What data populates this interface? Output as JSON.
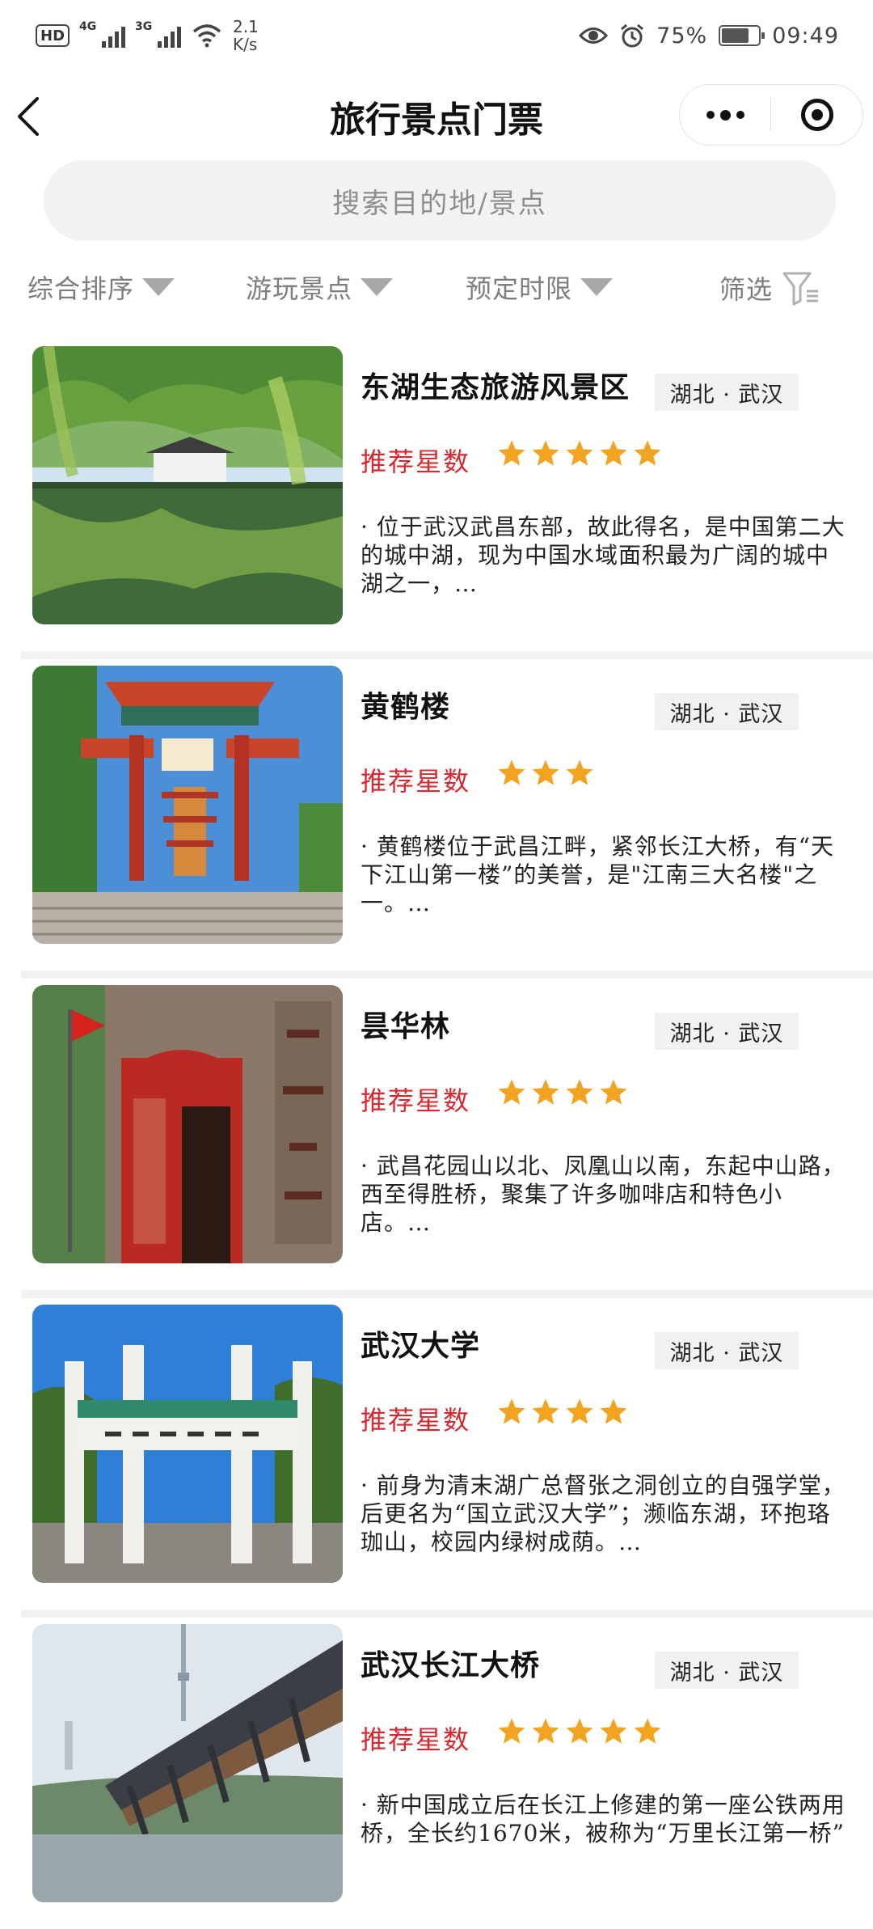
{
  "status_bar": {
    "hd": "HD",
    "net_4g": "4G",
    "net_3g": "3G",
    "speed_value": "2.1",
    "speed_unit": "K/s",
    "battery": "75%",
    "battery_level": 0.75,
    "time": "09:49"
  },
  "nav": {
    "title": "旅行景点门票"
  },
  "search": {
    "placeholder": "搜索目的地/景点"
  },
  "filters": {
    "sort": "综合排序",
    "spots": "游玩景点",
    "booking": "预定时限",
    "filter": "筛选"
  },
  "colors": {
    "accent_red": "#d9272e",
    "star": "#f2a31f"
  },
  "rating_label": "推荐星数",
  "attractions": [
    {
      "name": "东湖生态旅游风景区",
      "region": "湖北 · 武汉",
      "stars": 5,
      "description": "· 位于武汉武昌东部，故此得名，是中国第二大的城中湖，现为中国水域面积最为广阔的城中湖之一，…"
    },
    {
      "name": "黄鹤楼",
      "region": "湖北 · 武汉",
      "stars": 3,
      "description": "· 黄鹤楼位于武昌江畔，紧邻长江大桥，有“天下江山第一楼”的美誉，是\"江南三大名楼\"之一。…"
    },
    {
      "name": "昙华林",
      "region": "湖北 · 武汉",
      "stars": 4,
      "description": "· 武昌花园山以北、凤凰山以南，东起中山路，西至得胜桥，聚集了许多咖啡店和特色小店。…"
    },
    {
      "name": "武汉大学",
      "region": "湖北 · 武汉",
      "stars": 4,
      "description": "· 前身为清末湖广总督张之洞创立的自强学堂，后更名为“国立武汉大学”；濒临东湖，环抱珞珈山，校园内绿树成荫。…"
    },
    {
      "name": "武汉长江大桥",
      "region": "湖北 · 武汉",
      "stars": 5,
      "description": "· 新中国成立后在长江上修建的第一座公铁两用桥，全长约1670米，被称为“万里长江第一桥”"
    }
  ]
}
